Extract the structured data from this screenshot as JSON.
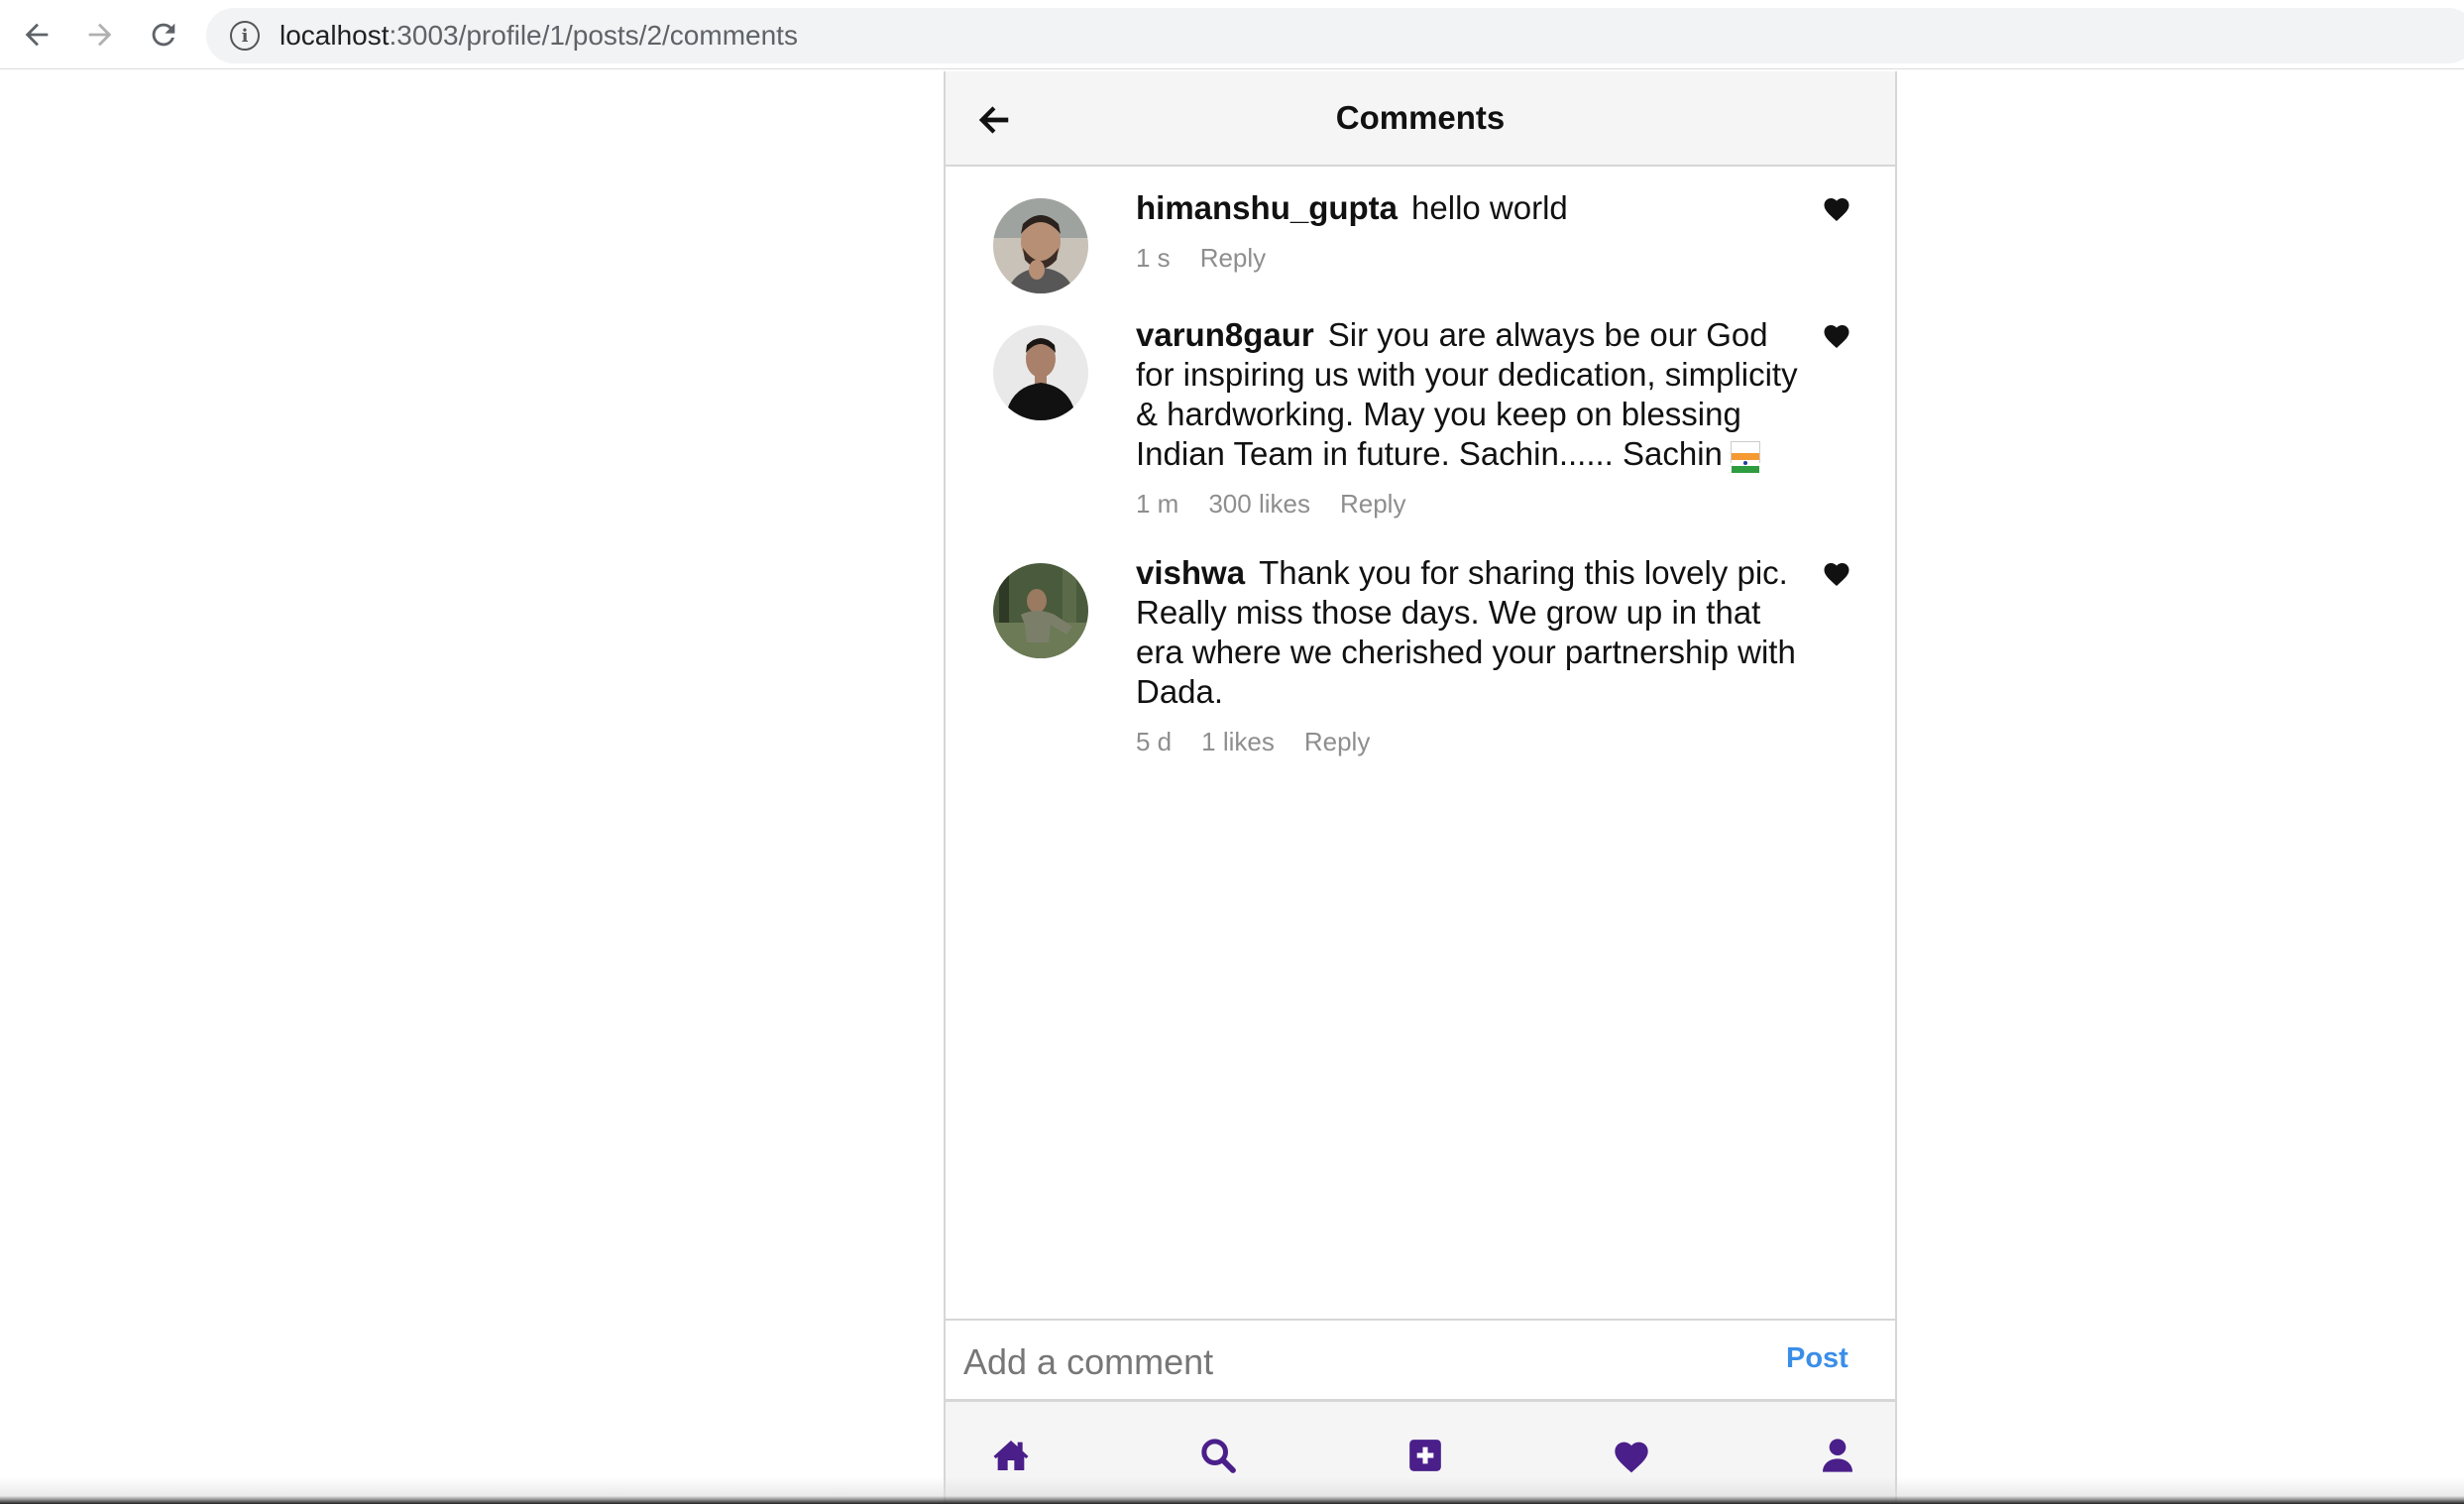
{
  "browser": {
    "url_host": "localhost",
    "url_path": ":3003/profile/1/posts/2/comments"
  },
  "header": {
    "title": "Comments"
  },
  "comments": [
    {
      "username": "himanshu_gupta",
      "text": "hello world",
      "time": "1 s",
      "likes": "",
      "reply_label": "Reply",
      "avatar_icon": "avatar-man-beard"
    },
    {
      "username": "varun8gaur",
      "text": "Sir you are always be our God for inspiring us with your dedication, simplicity & hardworking. May you keep on blessing Indian Team in future. Sachin...... Sachin",
      "flag_icon": "india-flag",
      "time": "1 m",
      "likes": "300 likes",
      "reply_label": "Reply",
      "avatar_icon": "avatar-man-black-shirt"
    },
    {
      "username": "vishwa",
      "text": "Thank you for sharing this lovely pic. Really miss those days. We grow up in that era where we cherished your partnership with Dada.",
      "time": "5 d",
      "likes": "1 likes",
      "reply_label": "Reply",
      "avatar_icon": "avatar-man-forest"
    }
  ],
  "composer": {
    "placeholder": "Add a comment",
    "post_label": "Post"
  },
  "colors": {
    "accent_blue": "#3b8ee8",
    "nav_purple": "#4a1f8a"
  },
  "bottom_nav": [
    "home-icon",
    "search-icon",
    "add-post-icon",
    "heart-icon",
    "profile-icon"
  ]
}
